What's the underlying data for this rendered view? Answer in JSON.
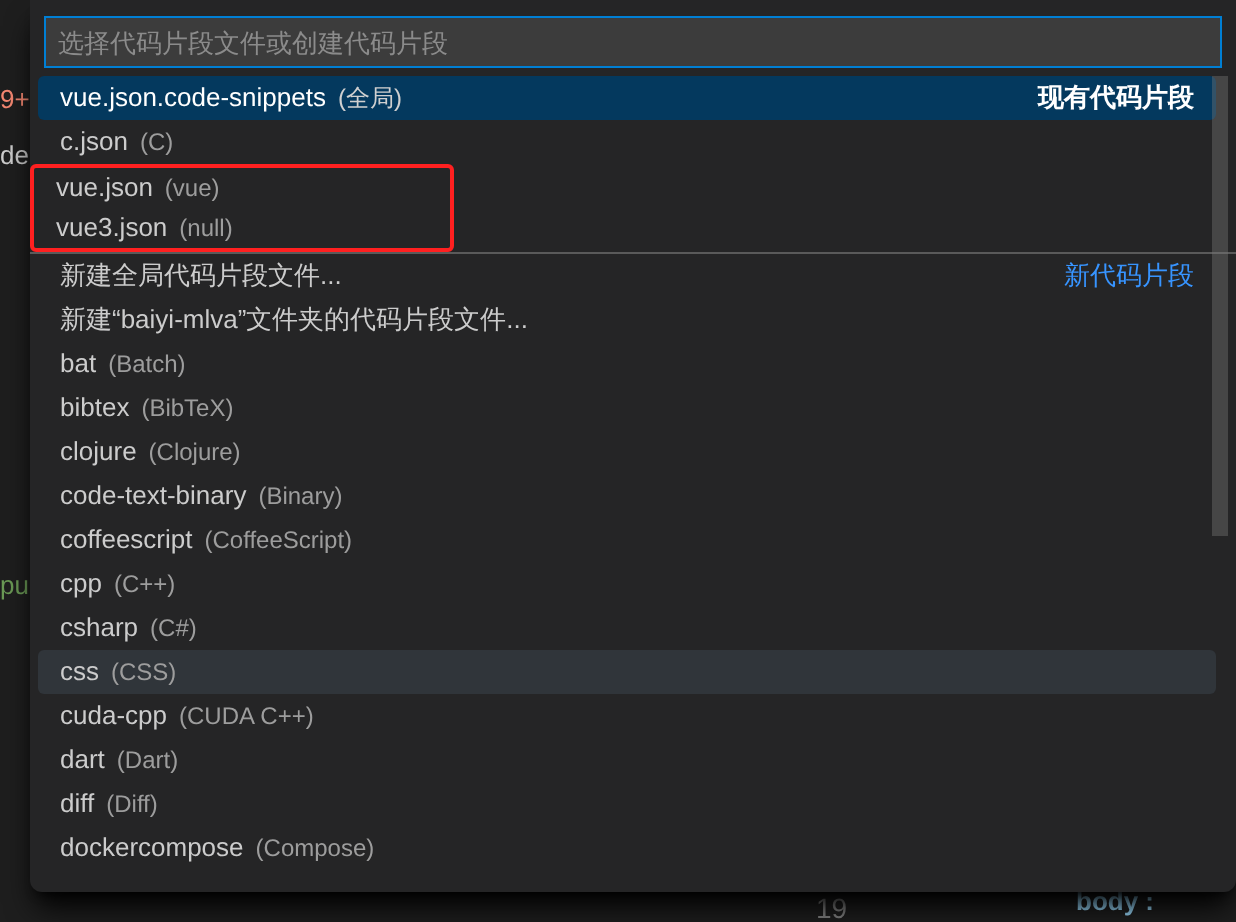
{
  "editor_background": {
    "fragments": [
      "9+",
      "de",
      "pu"
    ],
    "line_number": "19",
    "code": "body :"
  },
  "quick_pick": {
    "placeholder": "选择代码片段文件或创建代码片段",
    "items": [
      {
        "label": "vue.json.code-snippets",
        "detail": "(全局)",
        "group": "现有代码片段",
        "selected": true,
        "hovered": false,
        "separator_above": false,
        "annotated": false
      },
      {
        "label": "c.json",
        "detail": "(C)",
        "selected": false,
        "hovered": false,
        "separator_above": false,
        "annotated": false
      },
      {
        "label": "vue.json",
        "detail": "(vue)",
        "selected": false,
        "hovered": false,
        "separator_above": false,
        "annotated": true
      },
      {
        "label": "vue3.json",
        "detail": "(null)",
        "selected": false,
        "hovered": false,
        "separator_above": false,
        "annotated": true
      },
      {
        "label": "新建全局代码片段文件...",
        "group": "新代码片段",
        "selected": false,
        "hovered": false,
        "separator_above": true,
        "annotated": false
      },
      {
        "label": "新建“baiyi-mlva”文件夹的代码片段文件...",
        "selected": false,
        "hovered": false,
        "separator_above": false,
        "annotated": false
      },
      {
        "label": "bat",
        "detail": "(Batch)",
        "selected": false,
        "hovered": false,
        "separator_above": false,
        "annotated": false
      },
      {
        "label": "bibtex",
        "detail": "(BibTeX)",
        "selected": false,
        "hovered": false,
        "separator_above": false,
        "annotated": false
      },
      {
        "label": "clojure",
        "detail": "(Clojure)",
        "selected": false,
        "hovered": false,
        "separator_above": false,
        "annotated": false
      },
      {
        "label": "code-text-binary",
        "detail": "(Binary)",
        "selected": false,
        "hovered": false,
        "separator_above": false,
        "annotated": false
      },
      {
        "label": "coffeescript",
        "detail": "(CoffeeScript)",
        "selected": false,
        "hovered": false,
        "separator_above": false,
        "annotated": false
      },
      {
        "label": "cpp",
        "detail": "(C++)",
        "selected": false,
        "hovered": false,
        "separator_above": false,
        "annotated": false
      },
      {
        "label": "csharp",
        "detail": "(C#)",
        "selected": false,
        "hovered": false,
        "separator_above": false,
        "annotated": false
      },
      {
        "label": "css",
        "detail": "(CSS)",
        "selected": false,
        "hovered": true,
        "separator_above": false,
        "annotated": false
      },
      {
        "label": "cuda-cpp",
        "detail": "(CUDA C++)",
        "selected": false,
        "hovered": false,
        "separator_above": false,
        "annotated": false
      },
      {
        "label": "dart",
        "detail": "(Dart)",
        "selected": false,
        "hovered": false,
        "separator_above": false,
        "annotated": false
      },
      {
        "label": "diff",
        "detail": "(Diff)",
        "selected": false,
        "hovered": false,
        "separator_above": false,
        "annotated": false
      },
      {
        "label": "dockercompose",
        "detail": "(Compose)",
        "selected": false,
        "hovered": false,
        "separator_above": false,
        "annotated": false
      }
    ]
  }
}
